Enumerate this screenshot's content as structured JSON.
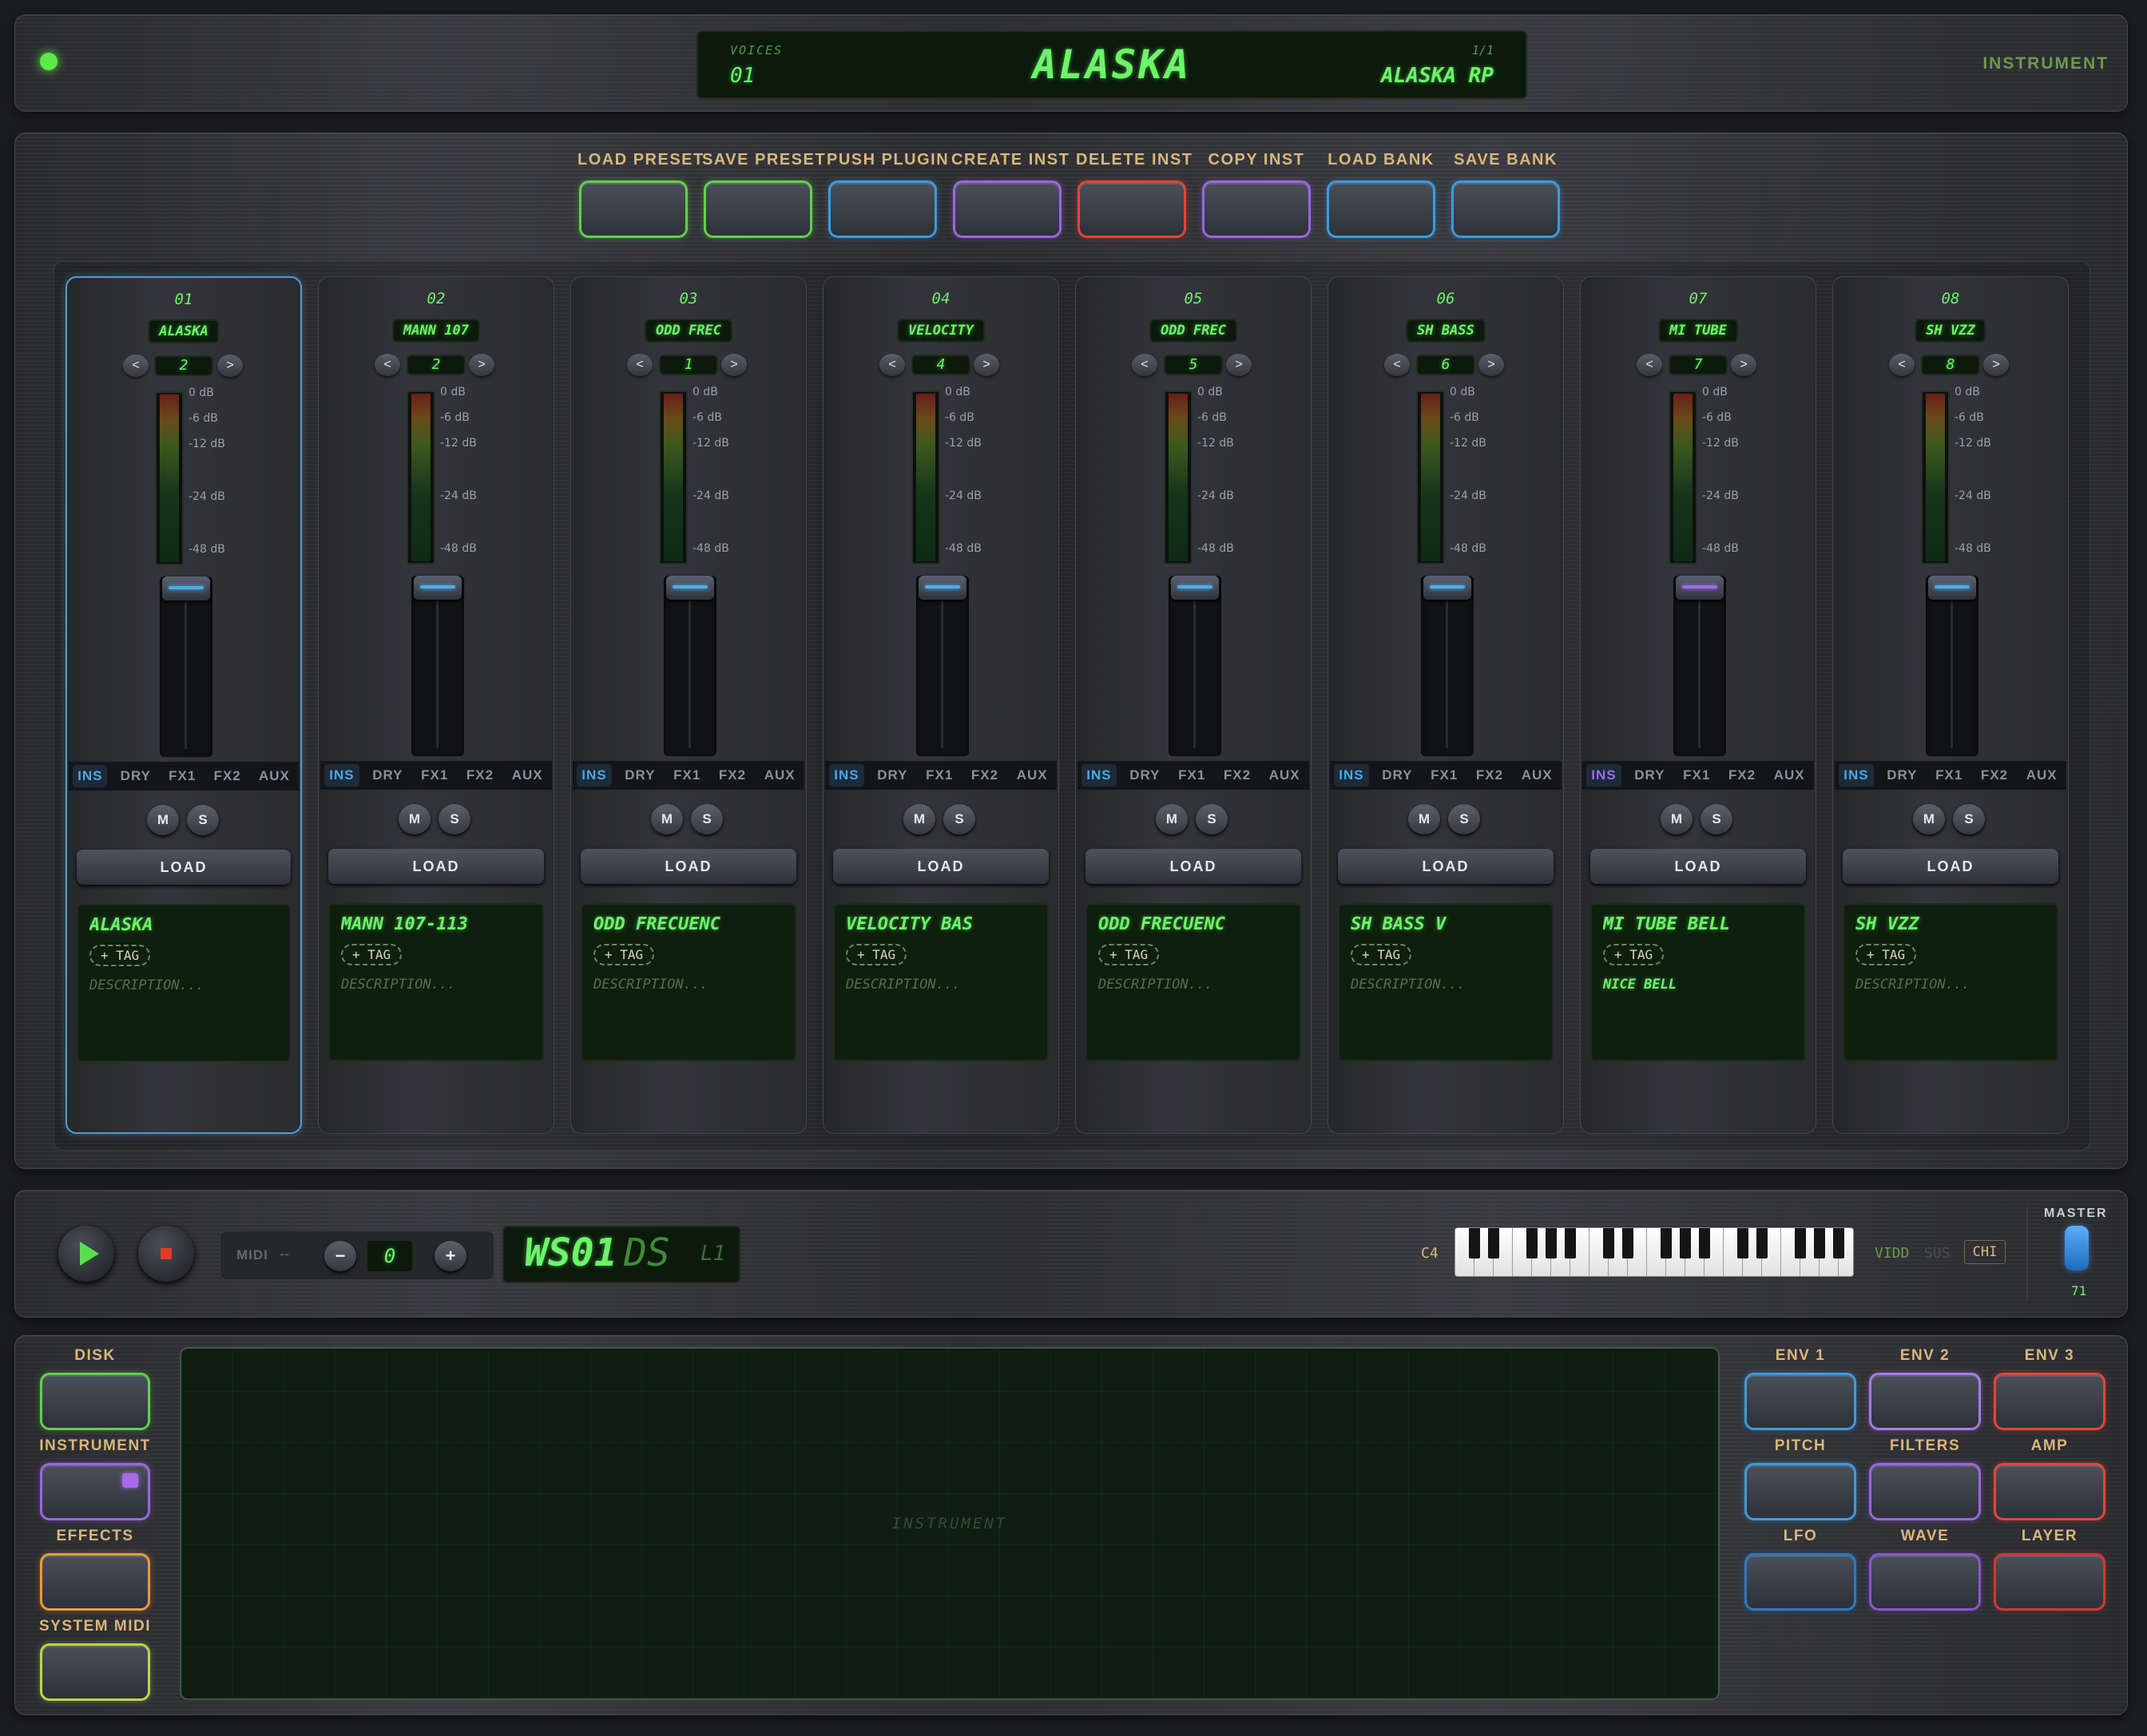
{
  "header": {
    "voices_label": "VOICES",
    "voices_value": "01",
    "title": "ALASKA",
    "page_indicator": "1/1",
    "preset_sub": "ALASKA RP",
    "mode_label": "INSTRUMENT"
  },
  "toolbar": [
    {
      "label": "LOAD PRESET",
      "color": "#5fd14a"
    },
    {
      "label": "SAVE PRESET",
      "color": "#5fd14a"
    },
    {
      "label": "PUSH PLUGIN",
      "color": "#3b9be0"
    },
    {
      "label": "CREATE INST",
      "color": "#9a66e0"
    },
    {
      "label": "DELETE INST",
      "color": "#e0463a"
    },
    {
      "label": "COPY INST",
      "color": "#9a66e0"
    },
    {
      "label": "LOAD BANK",
      "color": "#3b9be0"
    },
    {
      "label": "SAVE BANK",
      "color": "#3b9be0"
    }
  ],
  "strip_common": {
    "db_marks": [
      "0 dB",
      "-6 dB",
      "-12 dB",
      "-24 dB",
      "-48 dB"
    ],
    "routes": [
      "INS",
      "DRY",
      "FX1",
      "FX2",
      "AUX"
    ],
    "mute": "M",
    "solo": "S",
    "prev": "<",
    "next": ">",
    "load": "LOAD",
    "tag": "+ TAG"
  },
  "strips": [
    {
      "num": "01",
      "name": "ALASKA",
      "program": "2",
      "title": "ALASKA",
      "description": "DESCRIPTION...",
      "fader_color": "#4aaee8",
      "ins_color": "#49a8e8",
      "selected": true
    },
    {
      "num": "02",
      "name": "MANN 107",
      "program": "2",
      "title": "MANN 107-113",
      "description": "DESCRIPTION...",
      "fader_color": "#4aaee8",
      "ins_color": "#49a8e8",
      "selected": false
    },
    {
      "num": "03",
      "name": "ODD FREC",
      "program": "1",
      "title": "ODD FRECUENC",
      "description": "DESCRIPTION...",
      "fader_color": "#4aaee8",
      "ins_color": "#49a8e8",
      "selected": false
    },
    {
      "num": "04",
      "name": "VELOCITY",
      "program": "4",
      "title": "VELOCITY BAS",
      "description": "DESCRIPTION...",
      "fader_color": "#4aaee8",
      "ins_color": "#49a8e8",
      "selected": false
    },
    {
      "num": "05",
      "name": "ODD FREC",
      "program": "5",
      "title": "ODD FRECUENC",
      "description": "DESCRIPTION...",
      "fader_color": "#4aaee8",
      "ins_color": "#49a8e8",
      "selected": false
    },
    {
      "num": "06",
      "name": "SH BASS",
      "program": "6",
      "title": "SH BASS V",
      "description": "DESCRIPTION...",
      "fader_color": "#4aaee8",
      "ins_color": "#49a8e8",
      "selected": false
    },
    {
      "num": "07",
      "name": "MI TUBE",
      "program": "7",
      "title": "MI TUBE BELL",
      "description": "NICE BELL",
      "fader_color": "#a06ae8",
      "ins_color": "#a06ae8",
      "selected": false
    },
    {
      "num": "08",
      "name": "SH VZZ",
      "program": "8",
      "title": "SH VZZ",
      "description": "DESCRIPTION...",
      "fader_color": "#4aaee8",
      "ins_color": "#49a8e8",
      "selected": false
    }
  ],
  "transport": {
    "midi_label": "MIDI",
    "midi_value": "--",
    "minus": "−",
    "plus": "+",
    "midi_channel": "0",
    "seg_a": "WS01",
    "seg_b": "DS",
    "seg_c": "L1",
    "octave": "C4",
    "velo": "VIDD",
    "sus": "SUS",
    "chi": "CHI",
    "master_label": "MASTER",
    "master_value": "71"
  },
  "left_pads": [
    {
      "label": "DISK",
      "color": "#5fd14a"
    },
    {
      "label": "INSTRUMENT",
      "color": "#9a66e0"
    },
    {
      "label": "EFFECTS",
      "color": "#e89a3a"
    },
    {
      "label": "SYSTEM MIDI",
      "color": "#b8d84a"
    }
  ],
  "screen_label": "INSTRUMENT",
  "right_pads": [
    {
      "label": "ENV 1",
      "color": "#3b9be0"
    },
    {
      "label": "ENV 2",
      "color": "#a87ae8"
    },
    {
      "label": "ENV 3",
      "color": "#e0463a"
    },
    {
      "label": "PITCH",
      "color": "#3b9be0"
    },
    {
      "label": "FILTERS",
      "color": "#9a66e0"
    },
    {
      "label": "AMP",
      "color": "#e0463a"
    },
    {
      "label": "LFO",
      "color": "#2a7ac8"
    },
    {
      "label": "WAVE",
      "color": "#8a56d0"
    },
    {
      "label": "LAYER",
      "color": "#d03a30"
    }
  ]
}
